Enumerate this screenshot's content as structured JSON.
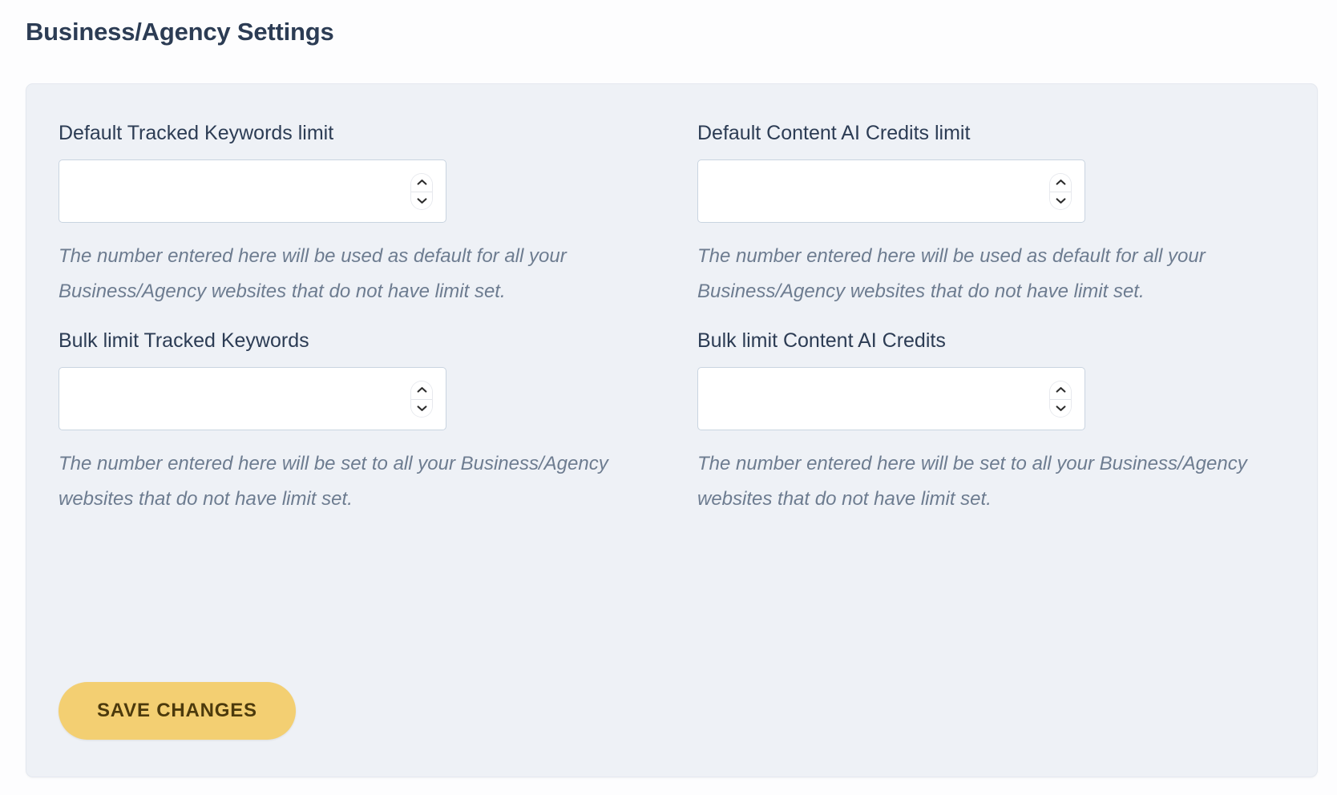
{
  "page": {
    "title": "Business/Agency Settings"
  },
  "colors": {
    "card_background": "#eef1f6",
    "card_border": "#e4e8ef",
    "label_text": "#2c3c54",
    "helper_text": "#6d7c90",
    "input_border": "#c9d4e0",
    "input_background": "#ffffff",
    "button_background": "#f3cf72",
    "button_text": "#4c3a0c"
  },
  "fields": [
    {
      "id": "default-tracked-keywords-limit",
      "label": "Default Tracked Keywords limit",
      "value": "",
      "placeholder": "",
      "helper": "The number entered here will be used as default for all your Business/Agency websites that do not have limit set.",
      "spinner": {
        "up_icon": "chevron-up-icon",
        "down_icon": "chevron-down-icon"
      }
    },
    {
      "id": "default-content-ai-credits-limit",
      "label": "Default Content AI Credits limit",
      "value": "",
      "placeholder": "",
      "helper": "The number entered here will be used as default for all your Business/Agency websites that do not have limit set.",
      "spinner": {
        "up_icon": "chevron-up-icon",
        "down_icon": "chevron-down-icon"
      }
    },
    {
      "id": "bulk-limit-tracked-keywords",
      "label": "Bulk limit Tracked Keywords",
      "value": "",
      "placeholder": "",
      "helper": "The number entered here will be set to all your Business/Agency websites that do not have limit set.",
      "spinner": {
        "up_icon": "chevron-up-icon",
        "down_icon": "chevron-down-icon"
      }
    },
    {
      "id": "bulk-limit-content-ai-credits",
      "label": "Bulk limit Content AI Credits",
      "value": "",
      "placeholder": "",
      "helper": "The number entered here will be set to all your Business/Agency websites that do not have limit set.",
      "spinner": {
        "up_icon": "chevron-up-icon",
        "down_icon": "chevron-down-icon"
      }
    }
  ],
  "actions": {
    "save_label": "SAVE CHANGES"
  }
}
